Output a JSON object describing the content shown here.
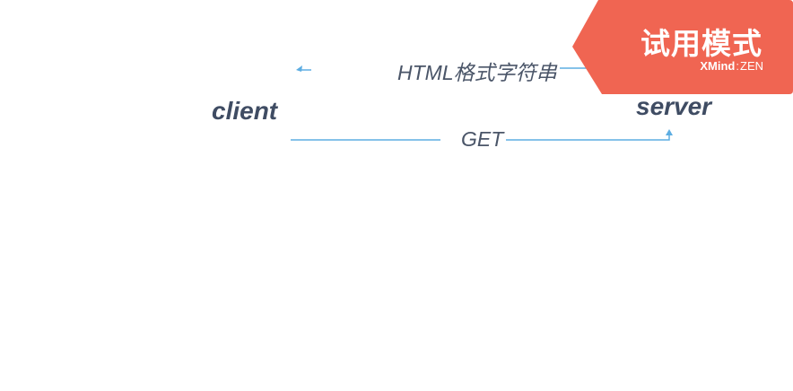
{
  "diagram": {
    "nodes": {
      "client": "client",
      "server": "server"
    },
    "edges": {
      "response_label": "HTML格式字符串",
      "request_label": "GET"
    },
    "line_color": "#5dade2"
  },
  "watermark": {
    "title": "试用模式",
    "brand": "XMind",
    "separator": ":",
    "edition": "ZEN",
    "background_color": "#f06552"
  }
}
